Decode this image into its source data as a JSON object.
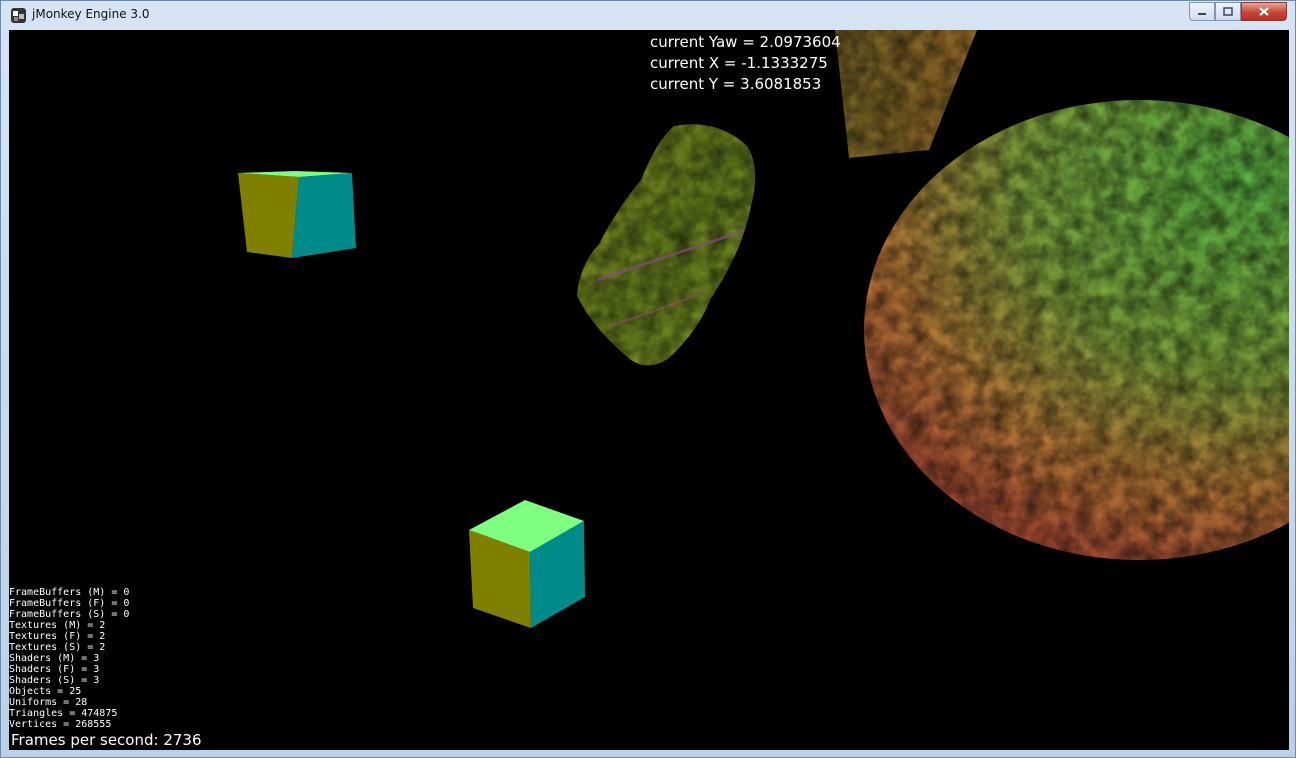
{
  "window": {
    "title": "jMonkey Engine 3.0"
  },
  "controls": {
    "minimize": "minimize-icon",
    "maximize": "maximize-icon",
    "close": "close-icon"
  },
  "camera": {
    "yaw": "current Yaw = 2.0973604",
    "x": "current X = -1.1333275",
    "y": "current Y = 3.6081853"
  },
  "stats": [
    "FrameBuffers (M) = 0",
    "FrameBuffers (F) = 0",
    "FrameBuffers (S) = 0",
    "Textures (M) = 2",
    "Textures (F) = 2",
    "Textures (S) = 2",
    "Shaders (M) = 3",
    "Shaders (F) = 3",
    "Shaders (S) = 3",
    "Objects = 25",
    "Uniforms = 28",
    "Triangles = 474875",
    "Vertices = 268555"
  ],
  "fps": "Frames per second: 2736",
  "colors": {
    "cube_top": "#7fff7f",
    "cube_left": "#808000",
    "cube_right": "#008b8b",
    "sphere_green": "#63c34a",
    "sphere_red": "#c2543c"
  }
}
